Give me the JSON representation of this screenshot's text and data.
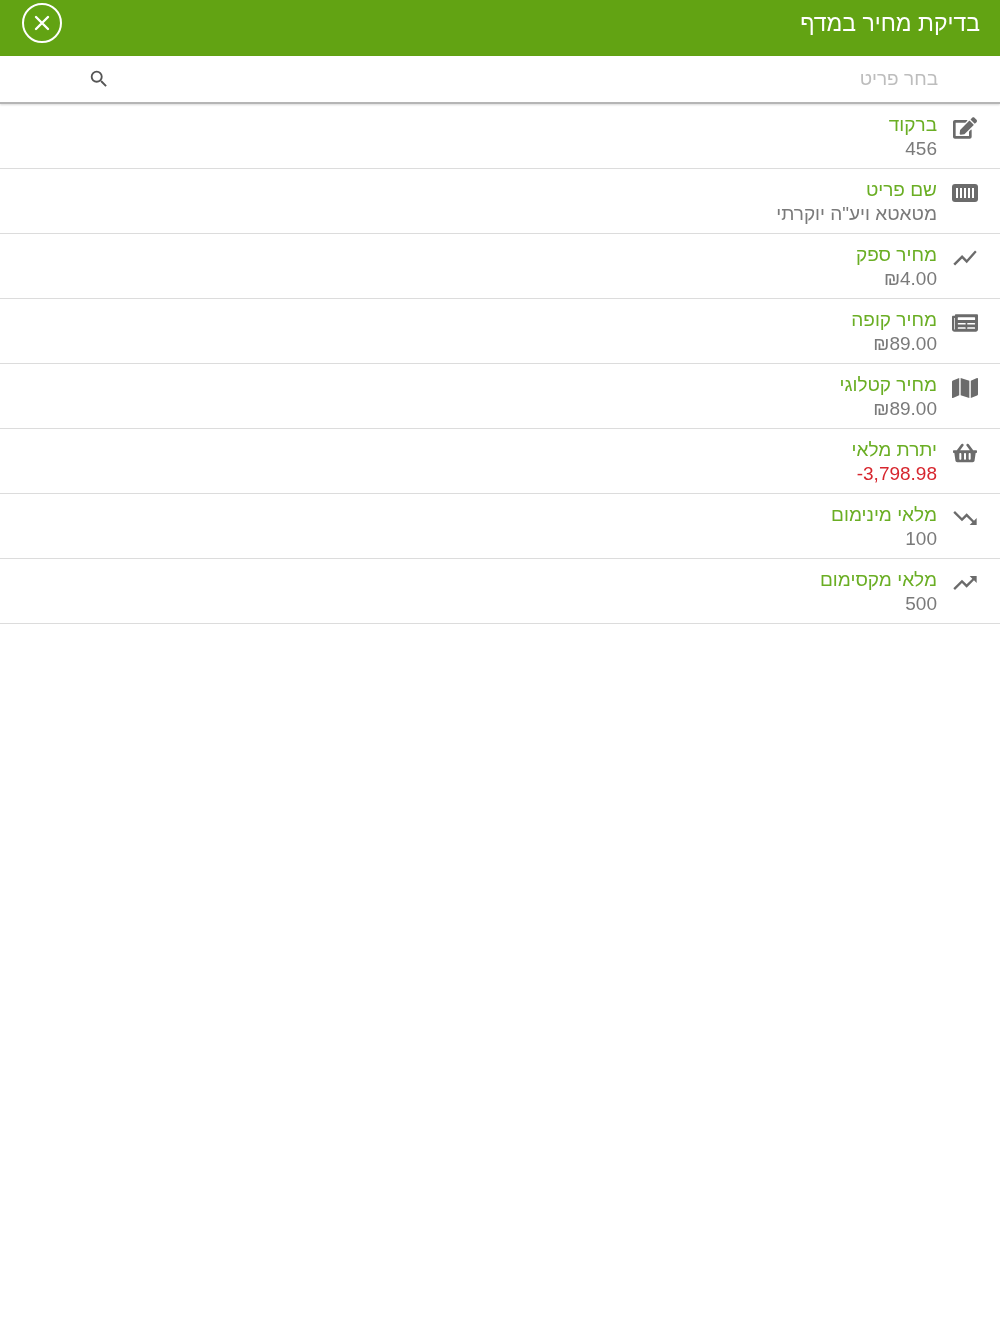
{
  "header": {
    "title": "בדיקת מחיר במדף"
  },
  "search": {
    "placeholder": "בחר פריט"
  },
  "fields": [
    {
      "label": "ברקוד",
      "value": "456",
      "warning": false
    },
    {
      "label": "שם פריט",
      "value": "מטאטא ויע\"ה יוקרתי",
      "warning": false
    },
    {
      "label": "מחיר ספק",
      "value": "₪4.00",
      "warning": false
    },
    {
      "label": "מחיר קופה",
      "value": "₪89.00",
      "warning": false
    },
    {
      "label": "מחיר קטלוגי",
      "value": "₪89.00",
      "warning": false
    },
    {
      "label": "יתרת מלאי",
      "value": "-3,798.98",
      "warning": true
    },
    {
      "label": "מלאי מינימום",
      "value": "100",
      "warning": false
    },
    {
      "label": "מלאי מקסימום",
      "value": "500",
      "warning": false
    }
  ]
}
